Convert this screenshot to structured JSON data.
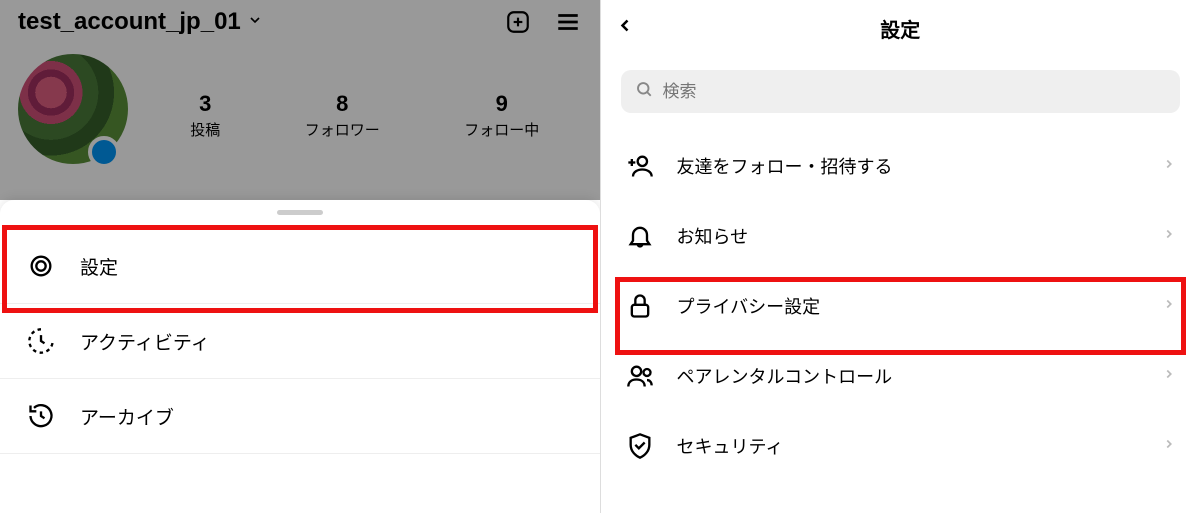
{
  "left": {
    "username": "test_account_jp_01",
    "stats": [
      {
        "num": "3",
        "label": "投稿"
      },
      {
        "num": "8",
        "label": "フォロワー"
      },
      {
        "num": "9",
        "label": "フォロー中"
      }
    ],
    "menu": [
      {
        "label": "設定",
        "icon": "gear"
      },
      {
        "label": "アクティビティ",
        "icon": "activity"
      },
      {
        "label": "アーカイブ",
        "icon": "archive"
      }
    ]
  },
  "right": {
    "title": "設定",
    "search_placeholder": "検索",
    "items": [
      {
        "label": "友達をフォロー・招待する",
        "icon": "add-person"
      },
      {
        "label": "お知らせ",
        "icon": "bell"
      },
      {
        "label": "プライバシー設定",
        "icon": "lock"
      },
      {
        "label": "ペアレンタルコントロール",
        "icon": "people"
      },
      {
        "label": "セキュリティ",
        "icon": "shield"
      }
    ]
  }
}
